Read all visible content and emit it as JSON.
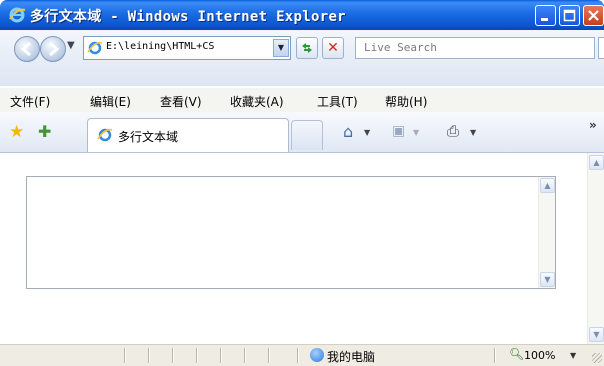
{
  "window": {
    "title": "多行文本域 - Windows Internet Explorer",
    "icon": "ie-icon",
    "controls": [
      "minimize-icon",
      "maximize-icon",
      "close-icon"
    ]
  },
  "navbar": {
    "address": "E:\\leining\\HTML+CS",
    "search_placeholder": "Live Search"
  },
  "menu": {
    "items": [
      "文件(F)",
      "编辑(E)",
      "查看(V)",
      "收藏夹(A)",
      "工具(T)",
      "帮助(H)"
    ]
  },
  "tabs": {
    "active_label": "多行文本域"
  },
  "status": {
    "zone": "我的电脑",
    "zoom": "100%"
  },
  "colors": {
    "titlebar": "#0b55d0",
    "close": "#c4401c",
    "stop": "#d2281a"
  }
}
